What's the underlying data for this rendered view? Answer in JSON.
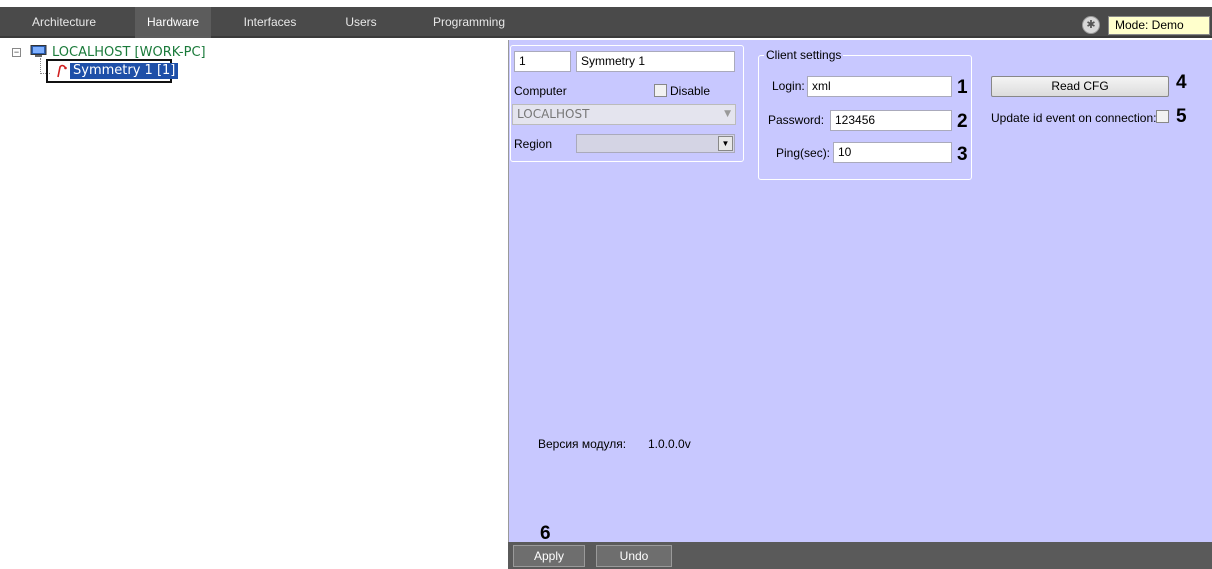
{
  "tabs": [
    {
      "label": "Architecture"
    },
    {
      "label": "Hardware",
      "active": true
    },
    {
      "label": "Interfaces"
    },
    {
      "label": "Users"
    },
    {
      "label": "Programming"
    }
  ],
  "mode_label": "Mode: Demo",
  "tree": {
    "expander": "−",
    "host": "LOCALHOST [WORK-PC]",
    "device": "Symmetry 1 [1]"
  },
  "device_panel": {
    "id": "1",
    "name": "Symmetry 1",
    "computer_label": "Computer",
    "disable_label": "Disable",
    "computer_value": "LOCALHOST",
    "region_label": "Region"
  },
  "client_settings": {
    "title": "Client settings",
    "login_label": "Login:",
    "login_value": "xml",
    "password_label": "Password:",
    "password_value": "123456",
    "ping_label": "Ping(sec):",
    "ping_value": "10"
  },
  "read_cfg_label": "Read CFG",
  "update_id_label": "Update id event on connection:",
  "markers": [
    "1",
    "2",
    "3",
    "4",
    "5",
    "6"
  ],
  "version_label": "Версия модуля:",
  "version_value": "1.0.0.0v",
  "bottom": {
    "apply_label": "Apply",
    "undo_label": "Undo"
  },
  "colors": {
    "tab_bar": "#4a4a4a",
    "panel_bg": "#c8c8ff",
    "selected": "#1e4fa8",
    "host_text": "#1a7a3a"
  }
}
